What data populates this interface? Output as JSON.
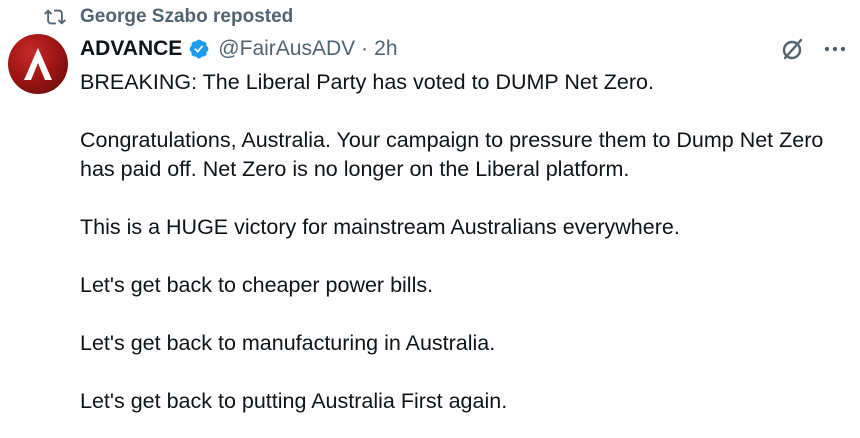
{
  "repost": {
    "text": "George Szabo reposted",
    "icon": "repost-icon"
  },
  "author": {
    "display_name": "ADVANCE",
    "verified": true,
    "handle": "@FairAusADV",
    "separator": "·",
    "time": "2h",
    "avatar_letter": "A",
    "avatar_color": "#a11515"
  },
  "actions": {
    "grok_icon": "grok-icon",
    "more_icon": "more-icon"
  },
  "tweet": {
    "paragraphs": [
      "BREAKING: The Liberal Party has voted to DUMP Net Zero.",
      "Congratulations, Australia. Your campaign to pressure them to Dump Net Zero has paid off. Net Zero is no longer on the Liberal platform.",
      "This is a HUGE victory for mainstream Australians everywhere.",
      "Let's get back to cheaper power bills.",
      "Let's get back to manufacturing in Australia.",
      "Let's get back to putting Australia First again."
    ]
  },
  "colors": {
    "text": "#0f1419",
    "muted": "#536471",
    "verified_blue": "#1d9bf0",
    "brand_red": "#a11515"
  }
}
